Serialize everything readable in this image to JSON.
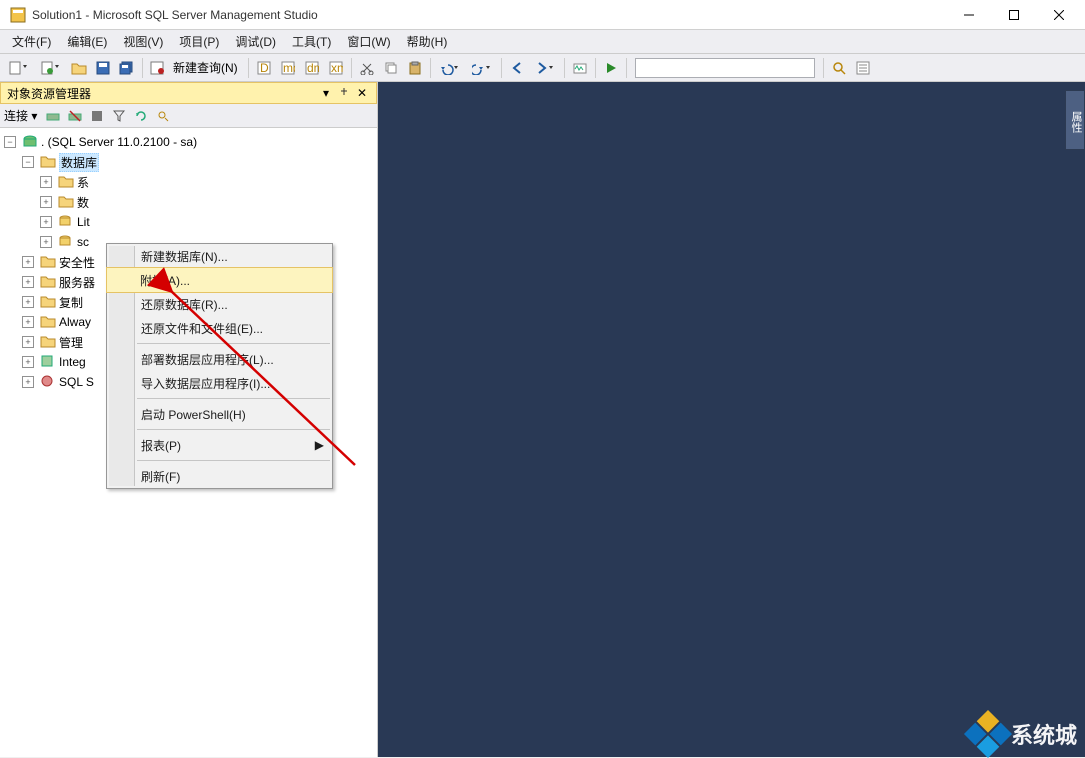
{
  "title": "Solution1 - Microsoft SQL Server Management Studio",
  "menus": [
    "文件(F)",
    "编辑(E)",
    "视图(V)",
    "项目(P)",
    "调试(D)",
    "工具(T)",
    "窗口(W)",
    "帮助(H)"
  ],
  "toolbar": {
    "new_query": "新建查询(N)"
  },
  "object_explorer": {
    "title": "对象资源管理器",
    "connect_label": "连接 ▾",
    "server": ". (SQL Server 11.0.2100 - sa)",
    "db_node": "数据库",
    "children_l3": [
      "系",
      "数",
      "Lit",
      "sc"
    ],
    "children_l2": [
      "安全性",
      "服务器",
      "复制",
      "Alway",
      "管理",
      "Integ",
      "SQL S"
    ]
  },
  "context_menu": {
    "items": [
      {
        "label": "新建数据库(N)...",
        "sep_after": false
      },
      {
        "label": "附加(A)...",
        "hover": true,
        "sep_after": false
      },
      {
        "label": "还原数据库(R)...",
        "sep_after": false
      },
      {
        "label": "还原文件和文件组(E)...",
        "sep_after": true
      },
      {
        "label": "部署数据层应用程序(L)...",
        "sep_after": false
      },
      {
        "label": "导入数据层应用程序(I)...",
        "sep_after": true
      },
      {
        "label": "启动 PowerShell(H)",
        "sep_after": true
      },
      {
        "label": "报表(P)",
        "submenu": true,
        "sep_after": true
      },
      {
        "label": "刷新(F)",
        "sep_after": false
      }
    ]
  },
  "dock_tab": "属性",
  "watermark": "系统城"
}
